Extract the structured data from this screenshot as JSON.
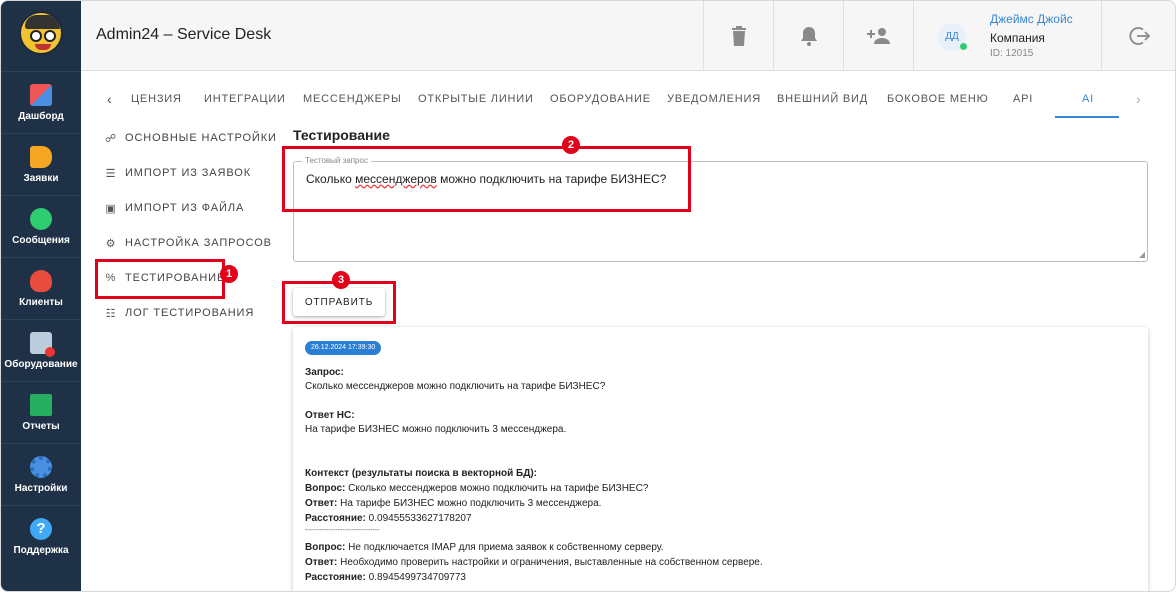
{
  "app": {
    "title": "Admin24 – Service Desk"
  },
  "colors": {
    "sidebar": "#1f3146",
    "accent": "#3a86d4",
    "highlight": "#e3001b",
    "badge": "#2a7fd4"
  },
  "sidebar": {
    "items": [
      {
        "label": "Дашборд",
        "icon": "dashboard-icon"
      },
      {
        "label": "Заявки",
        "icon": "megaphone-icon"
      },
      {
        "label": "Сообщения",
        "icon": "chat-icon"
      },
      {
        "label": "Клиенты",
        "icon": "clients-icon"
      },
      {
        "label": "Оборудование",
        "icon": "equipment-icon"
      },
      {
        "label": "Отчеты",
        "icon": "reports-icon"
      },
      {
        "label": "Настройки",
        "icon": "settings-gear-icon"
      },
      {
        "label": "Поддержка",
        "icon": "help-icon"
      }
    ]
  },
  "header": {
    "icons": [
      "trash-icon",
      "bell-icon",
      "add-user-icon",
      "logout-icon"
    ],
    "user": {
      "initials": "ДД",
      "name": "Джеймс Джойс",
      "company": "Компания",
      "id": "ID: 12015"
    }
  },
  "tabs": {
    "items": [
      "ЦЕНЗИЯ",
      "ИНТЕГРАЦИИ",
      "МЕССЕНДЖЕРЫ",
      "ОТКРЫТЫЕ ЛИНИИ",
      "ОБОРУДОВАНИЕ",
      "УВЕДОМЛЕНИЯ",
      "ВНЕШНИЙ ВИД",
      "БОКОВОЕ МЕНЮ",
      "API",
      "AI"
    ],
    "active": "AI"
  },
  "submenu": {
    "items": [
      {
        "label": "ОСНОВНЫЕ НАСТРОЙКИ",
        "icon": "settings-sliders-icon"
      },
      {
        "label": "ИМПОРТ ИЗ ЗАЯВОК",
        "icon": "receipt-icon"
      },
      {
        "label": "ИМПОРТ ИЗ ФАЙЛА",
        "icon": "file-icon"
      },
      {
        "label": "НАСТРОЙКА ЗАПРОСОВ",
        "icon": "cog-icon"
      },
      {
        "label": "ТЕСТИРОВАНИЕ",
        "icon": "percent-icon"
      },
      {
        "label": "ЛОГ ТЕСТИРОВАНИЯ",
        "icon": "list-icon"
      }
    ]
  },
  "main": {
    "section_title": "Тестирование",
    "query_field": {
      "label": "Тестовый запрос",
      "value_before": "Сколько ",
      "value_spell": "мессенджеров",
      "value_after": " можно подключить на тарифе БИЗНЕС?"
    },
    "send_button": "ОТПРАВИТЬ"
  },
  "result": {
    "timestamp": "26.12.2024 17:39:30",
    "request_label": "Запрос:",
    "request_text": "Сколько мессенджеров можно подключить на тарифе БИЗНЕС?",
    "answer_label": "Ответ НС:",
    "answer_text": "На тарифе БИЗНЕС можно подключить 3 мессенджера.",
    "context_label": "Контекст (результаты поиска в векторной БД):",
    "question_label": "Вопрос:",
    "answer_short_label": "Ответ:",
    "distance_label": "Расстояние:",
    "context": [
      {
        "question": "Сколько мессенджеров можно подключить на тарифе БИЗНЕС?",
        "answer": "На тарифе БИЗНЕС можно подключить 3 мессенджера.",
        "distance": "0.09455533627178207"
      },
      {
        "question": "Не подключается IMAP для приема заявок к собственному серверу.",
        "answer": "Необходимо проверить настройки и ограничения, выставленные на собственном сервере.",
        "distance": "0.8945499734709773"
      }
    ],
    "separator": "--------------------------------"
  },
  "annotations": [
    "1",
    "2",
    "3"
  ]
}
